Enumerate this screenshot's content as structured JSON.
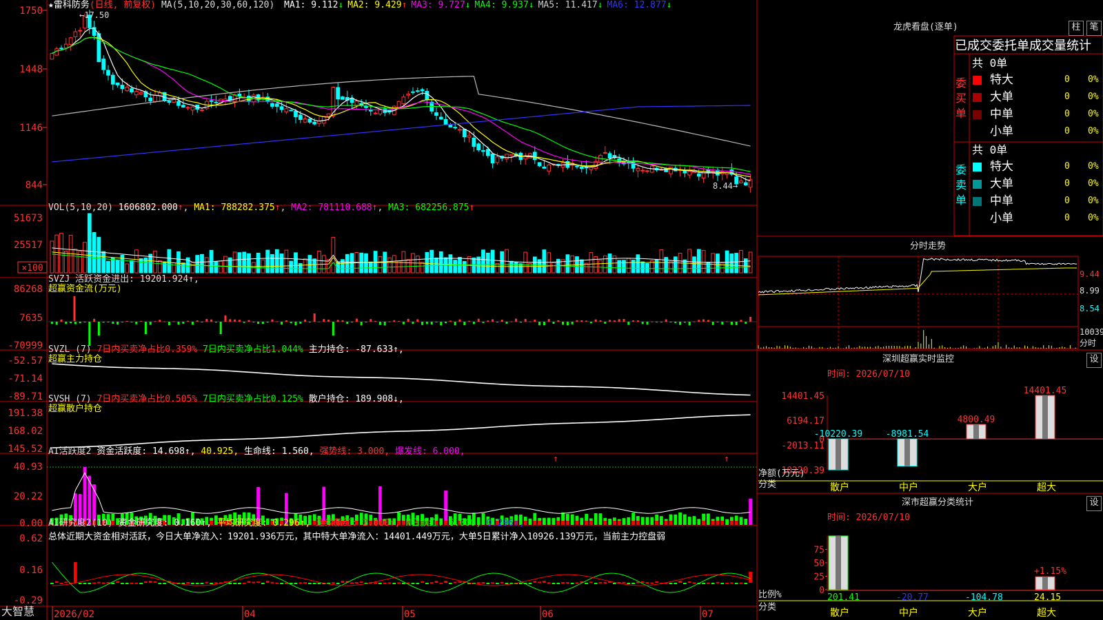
{
  "app": {
    "brand": "大智慧"
  },
  "main_chart": {
    "title": "★雷科防务",
    "period": "(日线, 前复权)",
    "ma_label": "MA(5,10,20,30,60,120)",
    "ma": [
      {
        "name": "MA1:",
        "value": "9.112",
        "arrow": "↓",
        "color": "#ffffff"
      },
      {
        "name": "MA2:",
        "value": "9.429",
        "arrow": "↑",
        "color": "#ffff00"
      },
      {
        "name": "MA3:",
        "value": "9.727",
        "arrow": "↓",
        "color": "#ff00ff"
      },
      {
        "name": "MA4:",
        "value": "9.937",
        "arrow": "↓",
        "color": "#00ff00"
      },
      {
        "name": "MA5:",
        "value": "11.417",
        "arrow": "↓",
        "color": "#cccccc"
      },
      {
        "name": "MA6:",
        "value": "12.877",
        "arrow": "↓",
        "color": "#3333ff"
      }
    ],
    "high_marker": "17.50",
    "low_marker": "8.44",
    "y_ticks": [
      "1750",
      "1448",
      "1146",
      "844"
    ]
  },
  "vol_panel": {
    "label": "VOL(5,10,20)",
    "value": "1606802.000",
    "ma1": "MA1: 788282.375",
    "ma2": "MA2: 781110.688",
    "ma3": "MA3: 682256.875",
    "y_ticks": [
      "51673",
      "25517",
      "×100"
    ]
  },
  "svzj_panel": {
    "label": "SVZJ 活跃资金进出: 19201.924↑,",
    "sub": "超赢资金流(万元)",
    "y_ticks": [
      "86268",
      "7635",
      "-70999"
    ]
  },
  "svzl_panel": {
    "prefix": "SVZL (7)",
    "a": "7日内买卖净占比0.359%",
    "b": "7日内买卖净占比1.044%",
    "c": "主力持仓: -87.633↑,",
    "sub": "超赢主力持仓",
    "y_ticks": [
      "-52.57",
      "-71.14",
      "-89.71"
    ]
  },
  "svsh_panel": {
    "prefix": "SVSH (7)",
    "a": "7日内买卖净占比0.505%",
    "b": "7日内买卖净占比0.125%",
    "c": "散户持仓: 189.908↓,",
    "sub": "超赢散户持仓",
    "y_ticks": [
      "191.38",
      "168.02",
      "145.52"
    ]
  },
  "ai_active_panel": {
    "prefix": "AI活跃度2",
    "a": "资金活跃度: 14.698↑,",
    "b": "40.925,",
    "c": "生命线: 1.560,",
    "d": "强势线: 3.000,",
    "e": "爆发线: 6.000,",
    "y_ticks": [
      "40.93",
      "20.22",
      "0.00"
    ]
  },
  "ai_research_panel": {
    "prefix": "AI研究度2(10)",
    "a": "资金研究度: 0.160↑,",
    "b": "平均研究度: 0.296↑,",
    "c": "连续飘红: 2.000↑,",
    "d": "N日飘红: 6.000,",
    "e": "0.296↑,",
    "summary": "总体近期大资金相对活跃，今日大单净流入：19201.936万元，其中特大单净流入：14401.449万元，大单5日累计净入10926.139万元，当前主力控盘弱",
    "y_ticks": [
      "0.62",
      "0.16",
      "-0.29"
    ]
  },
  "x_axis": [
    "2026/02",
    "04",
    "05",
    "06",
    "07"
  ],
  "dragon_tiger": {
    "title": "龙虎看盘(逐单)",
    "btn_bar": "柱",
    "btn_pen": "笔",
    "header": "已成交委托单成交量统计",
    "buy": {
      "label": "委买单",
      "total": "共 0单",
      "rows": [
        {
          "name": "特大",
          "count": "0",
          "pct": "0%",
          "color": "#ff0000"
        },
        {
          "name": "大单",
          "count": "0",
          "pct": "0%",
          "color": "#aa0000"
        },
        {
          "name": "中单",
          "count": "0",
          "pct": "0%",
          "color": "#770000"
        },
        {
          "name": "小单",
          "count": "0",
          "pct": "0%",
          "color": "#000000"
        }
      ]
    },
    "sell": {
      "label": "委卖单",
      "total": "共 0单",
      "rows": [
        {
          "name": "特大",
          "count": "0",
          "pct": "0%",
          "color": "#00ffff"
        },
        {
          "name": "大单",
          "count": "0",
          "pct": "0%",
          "color": "#009999"
        },
        {
          "name": "中单",
          "count": "0",
          "pct": "0%",
          "color": "#007777"
        },
        {
          "name": "小单",
          "count": "0",
          "pct": "0%",
          "color": "#000000"
        }
      ]
    }
  },
  "intraday": {
    "title": "分时走势",
    "y_ticks": [
      "9.44",
      "8.99",
      "8.54"
    ],
    "vol_tick": "10039",
    "vol_label": "分时"
  },
  "sz_monitor": {
    "title": "深圳超赢实时监控",
    "btn": "设",
    "time": "时间: 2026/07/10",
    "y_ticks": [
      "14401.45",
      "6194.17",
      "0",
      "-2013.11",
      "-10220.39"
    ],
    "ylabel": "净额(万元)",
    "xlabel": "分类",
    "chart_data": {
      "type": "bar",
      "categories": [
        "散户",
        "中户",
        "大户",
        "超大"
      ],
      "values": [
        -10220.39,
        -8981.54,
        4800.49,
        14401.45
      ],
      "labels": [
        "-10220.39",
        "-8981.54",
        "4800.49",
        "14401.45"
      ],
      "ylim": [
        -10220.39,
        14401.45
      ]
    }
  },
  "sz_class": {
    "title": "深市超赢分类统计",
    "btn": "设",
    "time": "时间: 2026/07/10",
    "y_ticks": [
      "75",
      "50",
      "25",
      "0"
    ],
    "ylabel": "比例%",
    "xlabel": "分类",
    "annotation": "+1.15%",
    "chart_data": {
      "type": "bar",
      "categories": [
        "散户",
        "中户",
        "大户",
        "超大"
      ],
      "values": [
        100,
        0,
        0,
        24.15
      ],
      "labels": [
        "201.41",
        "-20.77",
        "-104.78",
        "24.15"
      ],
      "ylim": [
        0,
        100
      ]
    }
  }
}
